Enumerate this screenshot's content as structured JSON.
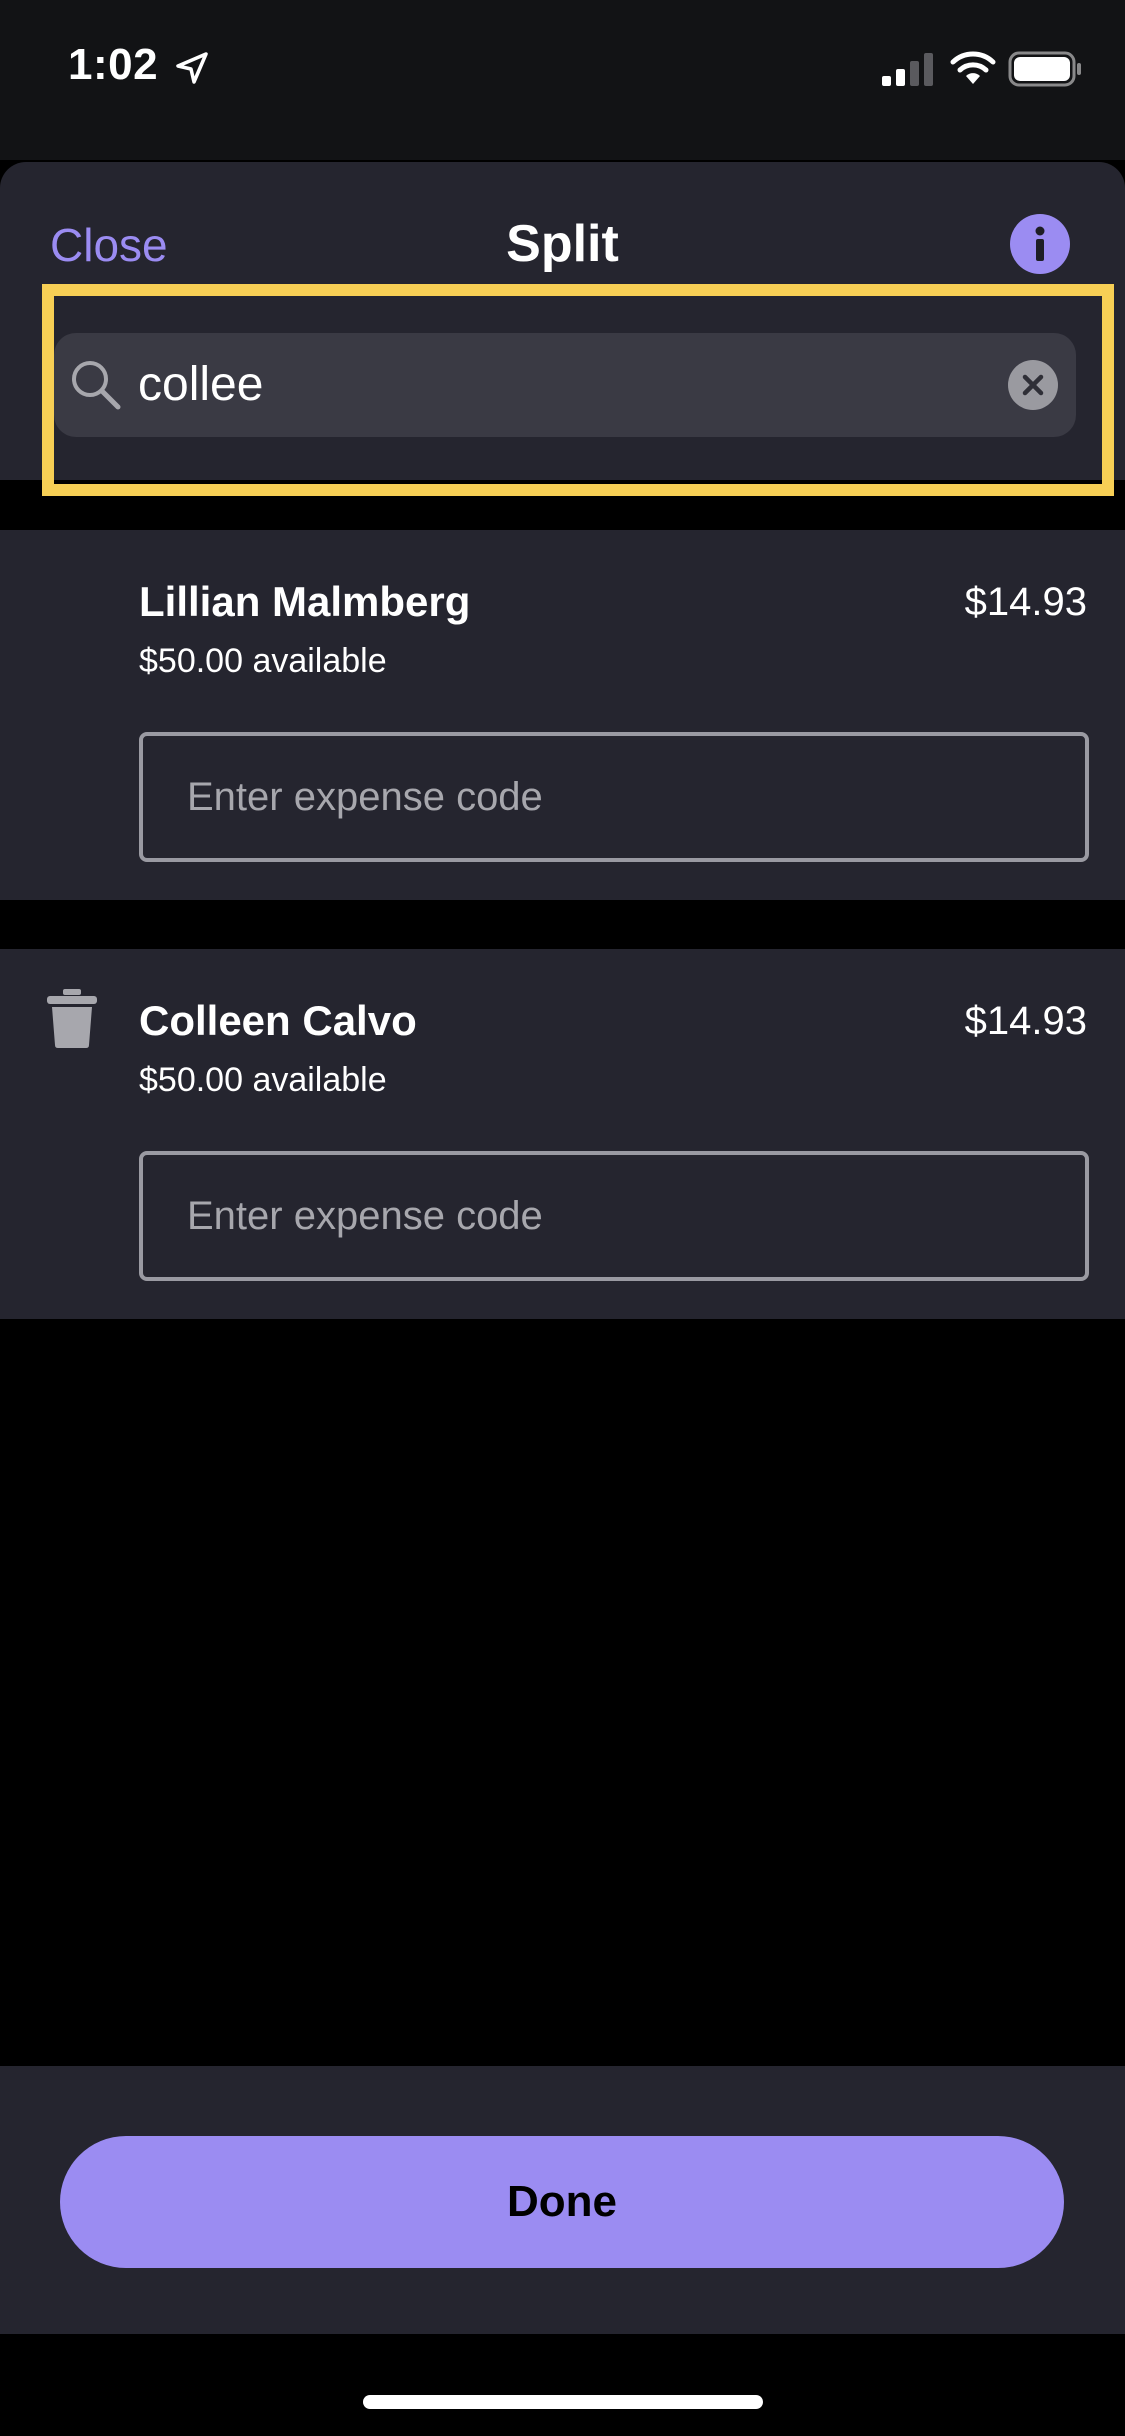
{
  "status_bar": {
    "time": "1:02"
  },
  "header": {
    "close_label": "Close",
    "title": "Split",
    "info_icon": "info-icon"
  },
  "search": {
    "value": "collee",
    "icon": "search-icon",
    "clear_icon": "clear-icon"
  },
  "splits": [
    {
      "name": "Lillian Malmberg",
      "available": "$50.00 available",
      "amount": "$14.93",
      "expense_placeholder": "Enter expense code",
      "deletable": false
    },
    {
      "name": "Colleen Calvo",
      "available": "$50.00 available",
      "amount": "$14.93",
      "expense_placeholder": "Enter expense code",
      "deletable": true
    }
  ],
  "footer": {
    "done_label": "Done"
  },
  "colors": {
    "accent": "#9b8cf2",
    "highlight": "#f7cf55",
    "surface": "#25252f",
    "background": "#000000"
  }
}
